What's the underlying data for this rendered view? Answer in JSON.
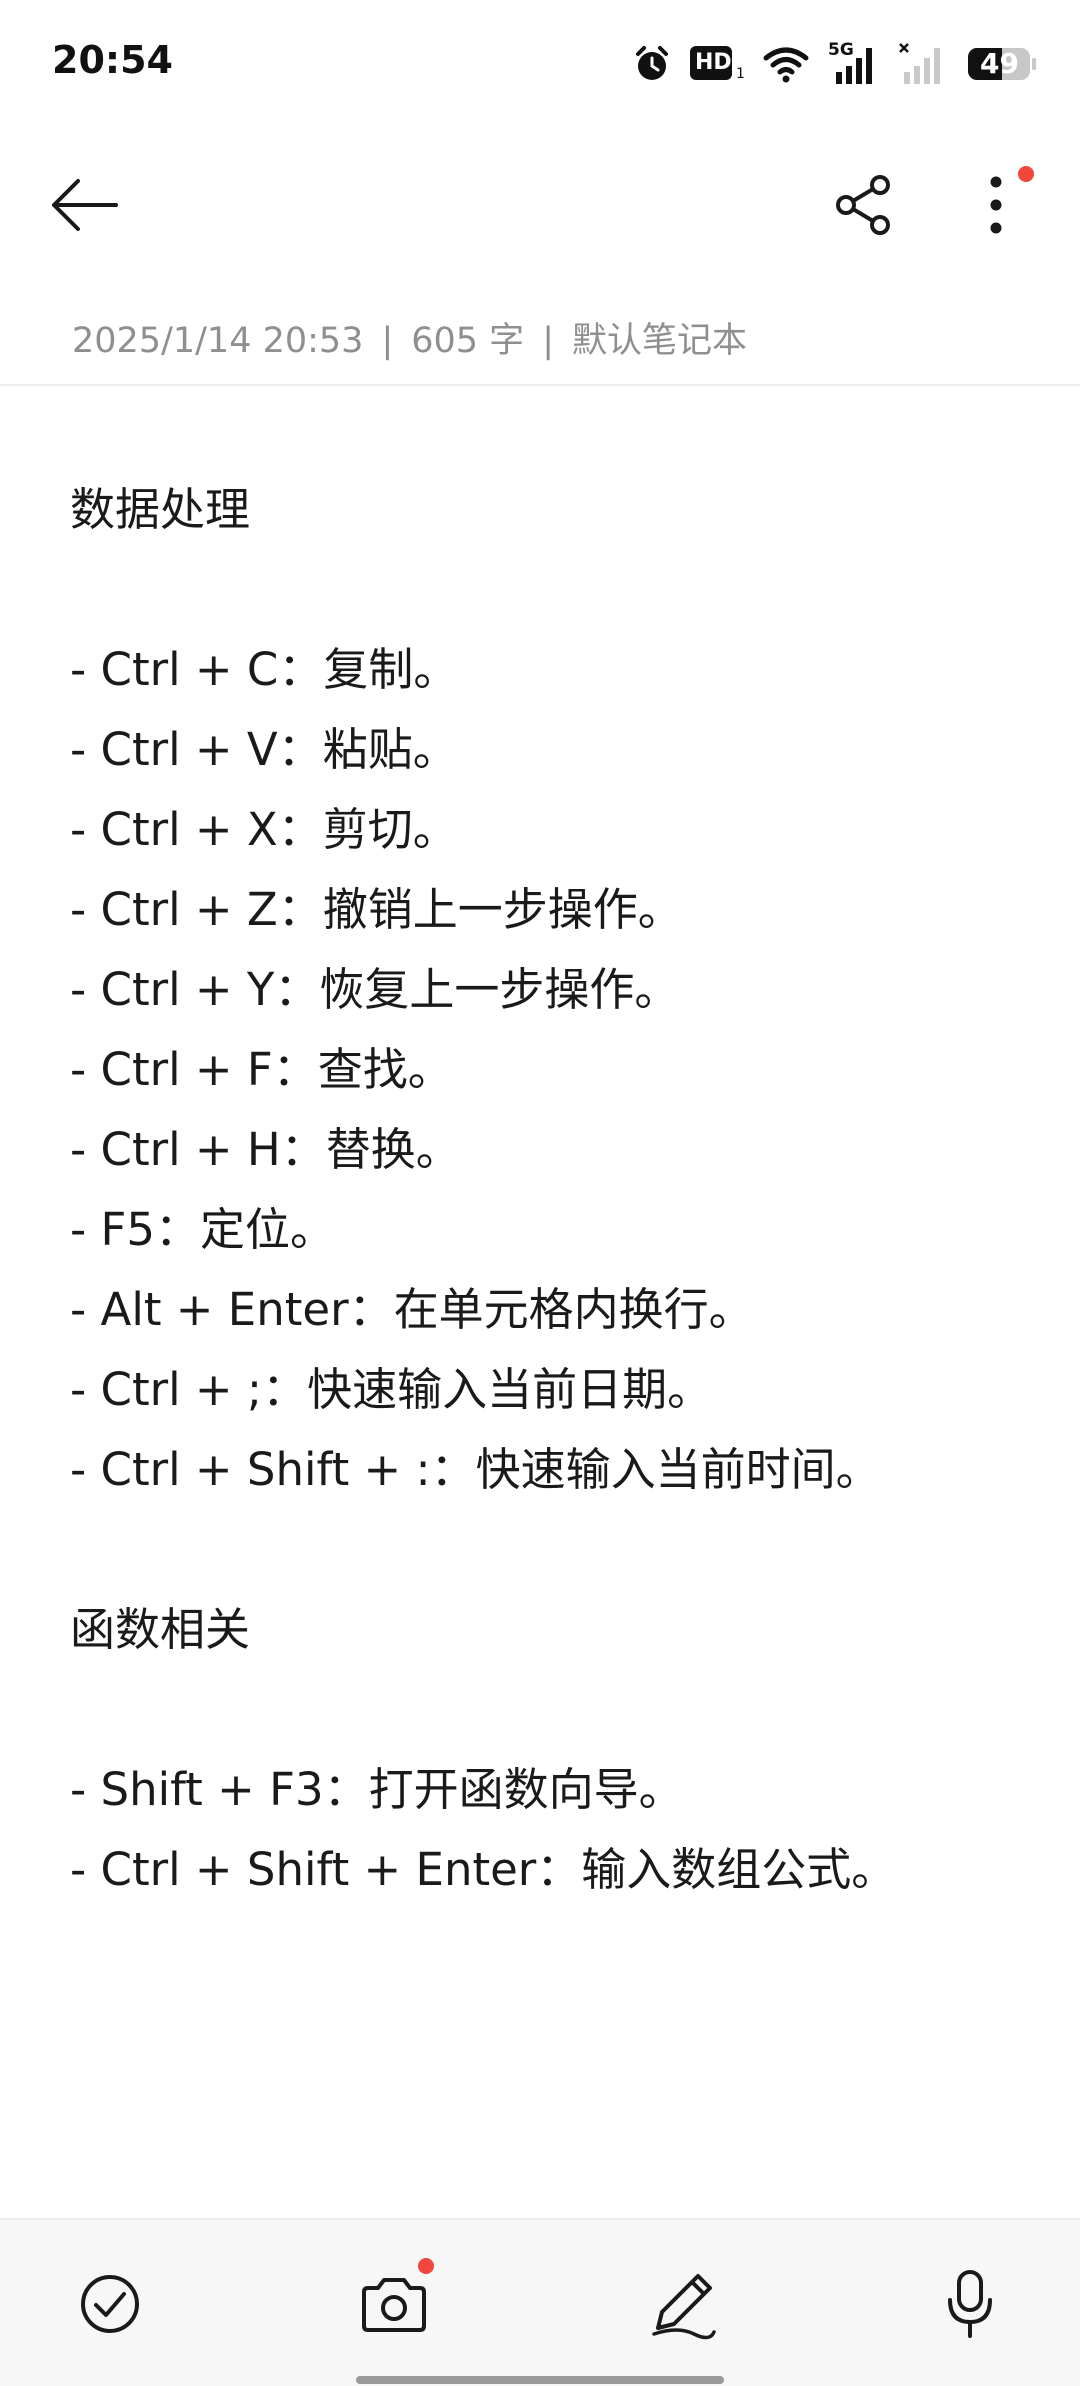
{
  "status_bar": {
    "time": "20:54",
    "battery_level": "49",
    "network_label": "5G",
    "hd_label": "HD"
  },
  "toolbar": {
    "back_icon": "arrow-left-icon",
    "share_icon": "share-icon",
    "more_icon": "more-vertical-icon",
    "accent_color": "#f0463c"
  },
  "note_meta": {
    "datetime": "2025/1/14 20:53",
    "word_count": "605 字",
    "notebook": "默认笔记本",
    "separator": "|"
  },
  "note": {
    "section1_title": "数据处理",
    "section1_items": [
      "- Ctrl + C：复制。",
      "- Ctrl + V：粘贴。",
      "- Ctrl + X：剪切。",
      "- Ctrl + Z：撤销上一步操作。",
      "- Ctrl + Y：恢复上一步操作。",
      "- Ctrl + F：查找。",
      "- Ctrl + H：替换。",
      "- F5：定位。",
      "- Alt + Enter：在单元格内换行。",
      "- Ctrl + ;：快速输入当前日期。",
      "- Ctrl + Shift + :：快速输入当前时间。"
    ],
    "section2_title": "函数相关",
    "section2_items": [
      "- Shift + F3：打开函数向导。",
      "- Ctrl + Shift + Enter：输入数组公式。"
    ]
  },
  "bottom_bar": {
    "checklist_icon": "checklist-icon",
    "camera_icon": "camera-icon",
    "pen_icon": "pen-icon",
    "mic_icon": "microphone-icon"
  }
}
